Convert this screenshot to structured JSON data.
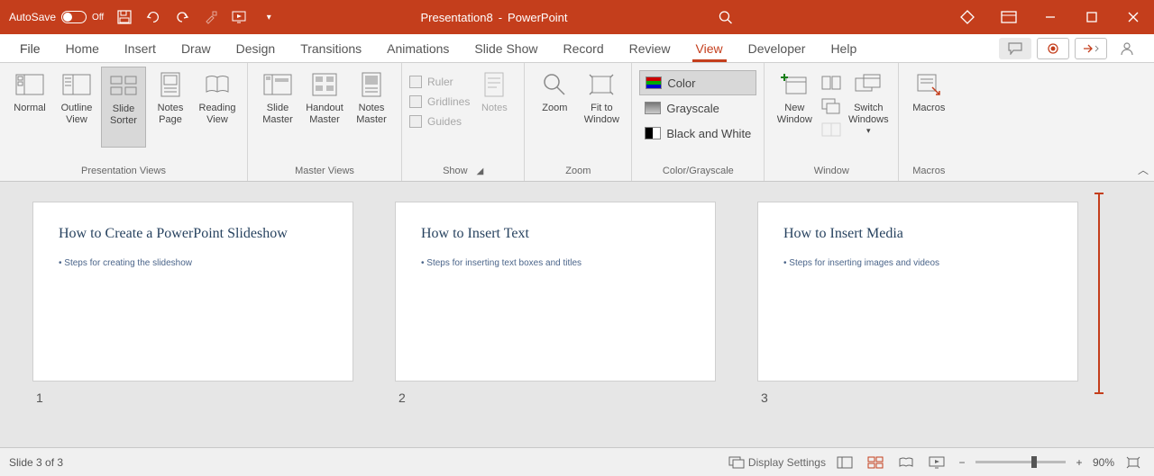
{
  "titlebar": {
    "autosave_label": "AutoSave",
    "autosave_state": "Off",
    "doc_name": "Presentation8",
    "app_suffix": "PowerPoint"
  },
  "tabs": {
    "file": "File",
    "items": [
      "Home",
      "Insert",
      "Draw",
      "Design",
      "Transitions",
      "Animations",
      "Slide Show",
      "Record",
      "Review",
      "View",
      "Developer",
      "Help"
    ],
    "active": "View"
  },
  "ribbon": {
    "presentation_views": {
      "label": "Presentation Views",
      "normal": "Normal",
      "outline": "Outline View",
      "sorter": "Slide Sorter",
      "notes_page": "Notes Page",
      "reading": "Reading View"
    },
    "master_views": {
      "label": "Master Views",
      "slide_master": "Slide Master",
      "handout_master": "Handout Master",
      "notes_master": "Notes Master"
    },
    "show": {
      "label": "Show",
      "ruler": "Ruler",
      "gridlines": "Gridlines",
      "guides": "Guides",
      "notes": "Notes"
    },
    "zoom": {
      "label": "Zoom",
      "zoom": "Zoom",
      "fit": "Fit to Window"
    },
    "color": {
      "label": "Color/Grayscale",
      "color": "Color",
      "grayscale": "Grayscale",
      "bw": "Black and White"
    },
    "window": {
      "label": "Window",
      "new_window": "New Window",
      "switch": "Switch Windows"
    },
    "macros": {
      "label": "Macros",
      "macros": "Macros"
    }
  },
  "slides": [
    {
      "num": "1",
      "title": "How to Create a PowerPoint Slideshow",
      "body": "Steps for creating the slideshow"
    },
    {
      "num": "2",
      "title": "How to Insert Text",
      "body": "Steps for inserting text boxes and titles"
    },
    {
      "num": "3",
      "title": "How to Insert Media",
      "body": "Steps for inserting images and videos"
    }
  ],
  "status": {
    "slide_counter": "Slide 3 of 3",
    "display_settings": "Display Settings",
    "zoom_pct": "90%"
  }
}
